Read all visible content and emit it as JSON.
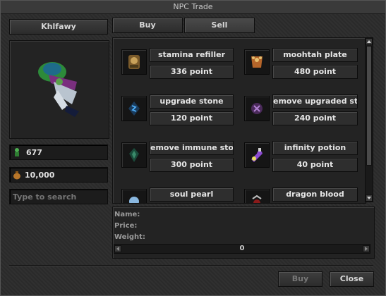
{
  "window": {
    "title": "NPC Trade"
  },
  "player": {
    "name": "Khlfawy",
    "capacity": "677",
    "gold": "10,000"
  },
  "search": {
    "placeholder": "Type to search"
  },
  "tabs": [
    {
      "label": "Buy"
    },
    {
      "label": "Sell"
    }
  ],
  "items": [
    {
      "name": "stamina refiller",
      "price": "336 point",
      "icon": "stamina-refiller-icon"
    },
    {
      "name": "moohtah plate",
      "price": "480 point",
      "icon": "moohtah-plate-icon"
    },
    {
      "name": "upgrade stone",
      "price": "120 point",
      "icon": "upgrade-stone-icon"
    },
    {
      "name": "emove upgraded stor",
      "price": "240 point",
      "icon": "remove-upgraded-stone-icon"
    },
    {
      "name": "emove immune ston",
      "price": "300 point",
      "icon": "remove-immune-stone-icon"
    },
    {
      "name": "infinity potion",
      "price": "40 point",
      "icon": "infinity-potion-icon"
    },
    {
      "name": "soul pearl",
      "price": "",
      "icon": "soul-pearl-icon"
    },
    {
      "name": "dragon blood",
      "price": "",
      "icon": "dragon-blood-icon"
    }
  ],
  "details": {
    "name_label": "Name:",
    "price_label": "Price:",
    "weight_label": "Weight:"
  },
  "amount": {
    "value": "0"
  },
  "footer": {
    "buy_label": "Buy",
    "close_label": "Close"
  }
}
